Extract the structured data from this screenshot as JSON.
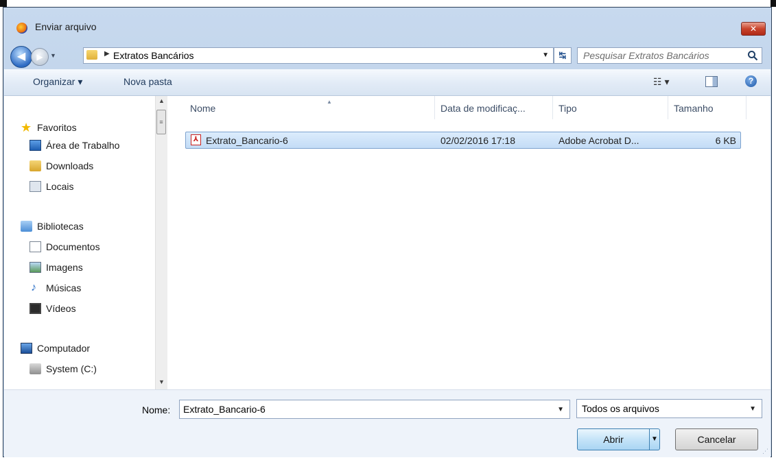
{
  "window": {
    "title": "Enviar arquivo",
    "close_label": "✕"
  },
  "navigation": {
    "path_current": "Extratos Bancários",
    "search_placeholder": "Pesquisar Extratos Bancários"
  },
  "toolbar": {
    "organize_label": "Organizar ▾",
    "new_folder_label": "Nova pasta"
  },
  "sidebar": {
    "favorites": {
      "label": "Favoritos",
      "items": [
        "Área de Trabalho",
        "Downloads",
        "Locais"
      ]
    },
    "libraries": {
      "label": "Bibliotecas",
      "items": [
        "Documentos",
        "Imagens",
        "Músicas",
        "Vídeos"
      ]
    },
    "computer": {
      "label": "Computador",
      "items": [
        "System (C:)"
      ]
    }
  },
  "file_list": {
    "columns": [
      "Nome",
      "Data de modificaç...",
      "Tipo",
      "Tamanho"
    ],
    "rows": [
      {
        "name": "Extrato_Bancario-6",
        "modified": "02/02/2016 17:18",
        "type": "Adobe Acrobat D...",
        "size": "6 KB",
        "selected": true
      }
    ]
  },
  "footer": {
    "name_label": "Nome:",
    "name_value": "Extrato_Bancario-6",
    "file_type_filter": "Todos os arquivos",
    "open_button": "Abrir",
    "cancel_button": "Cancelar"
  },
  "colors": {
    "accent": "#3c7fb1",
    "selection": "#cce4f7",
    "close_button": "#c9442c"
  }
}
